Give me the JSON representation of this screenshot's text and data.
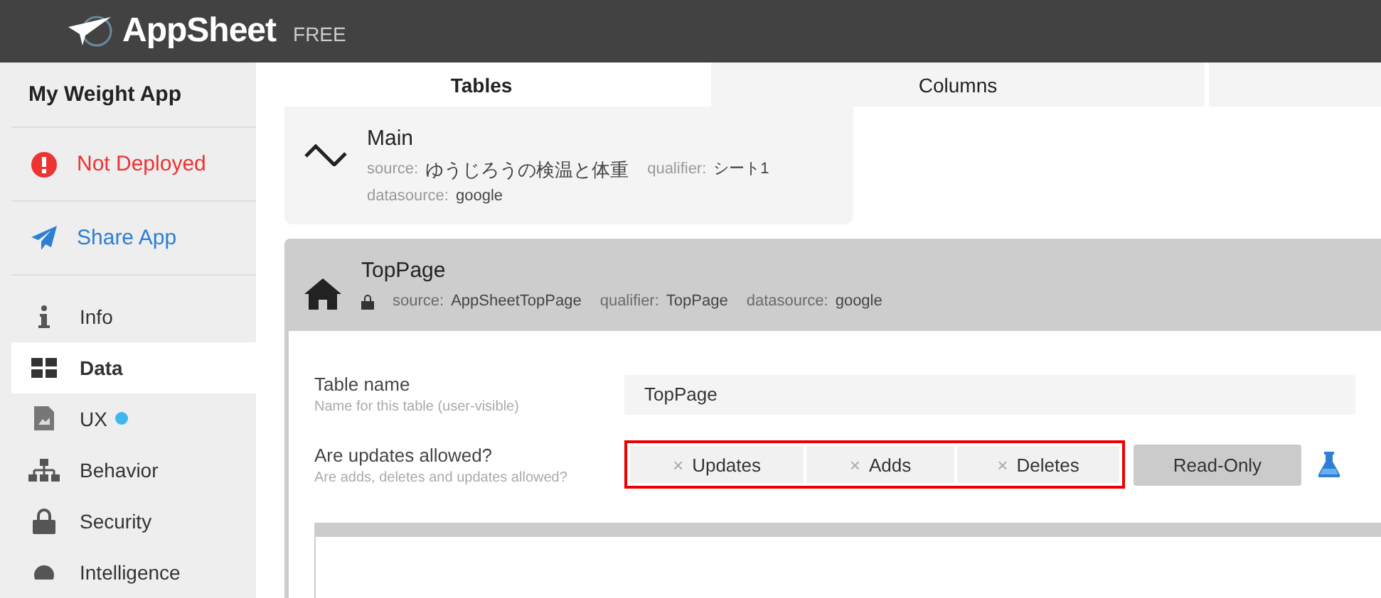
{
  "header": {
    "brand": "AppSheet",
    "plan": "FREE"
  },
  "sidebar": {
    "app_name": "My Weight App",
    "status": [
      {
        "kind": "alert",
        "label": "Not Deployed"
      },
      {
        "kind": "share",
        "label": "Share App"
      }
    ],
    "items": [
      {
        "kind": "info",
        "label": "Info",
        "selected": false
      },
      {
        "kind": "data",
        "label": "Data",
        "selected": true
      },
      {
        "kind": "ux",
        "label": "UX",
        "selected": false,
        "color": "#3db8ee"
      },
      {
        "kind": "behavior",
        "label": "Behavior",
        "selected": false
      },
      {
        "kind": "security",
        "label": "Security",
        "selected": false
      },
      {
        "kind": "intelligence",
        "label": "Intelligence",
        "selected": false
      }
    ]
  },
  "tabs": [
    {
      "label": "Tables",
      "selected": true
    },
    {
      "label": "Columns",
      "selected": false
    },
    {
      "selected": false
    }
  ],
  "tables": [
    {
      "kind": "wave",
      "name": "Main",
      "expanded": false,
      "locked": false,
      "source_label": "source:",
      "source": "ゆうじろうの検温と体重",
      "qualifier_label": "qualifier:",
      "qualifier": "シート1",
      "datasource_label": "datasource:",
      "datasource": "google"
    },
    {
      "kind": "home",
      "name": "TopPage",
      "expanded": true,
      "locked": true,
      "source_label": "source:",
      "source": "AppSheetTopPage",
      "qualifier_label": "qualifier:",
      "qualifier": "TopPage",
      "datasource_label": "datasource:",
      "datasource": "google"
    }
  ],
  "form": {
    "table_name": {
      "label": "Table name",
      "hint": "Name for this table (user-visible)",
      "value": "TopPage"
    },
    "updates": {
      "label": "Are updates allowed?",
      "hint": "Are adds, deletes and updates allowed?",
      "highlighted": true,
      "options": [
        {
          "mark": "×",
          "label": "Updates",
          "selected": false
        },
        {
          "mark": "×",
          "label": "Adds",
          "selected": false
        },
        {
          "mark": "×",
          "label": "Deletes",
          "selected": false
        }
      ],
      "read_only": {
        "label": "Read-Only",
        "selected": true
      }
    }
  }
}
